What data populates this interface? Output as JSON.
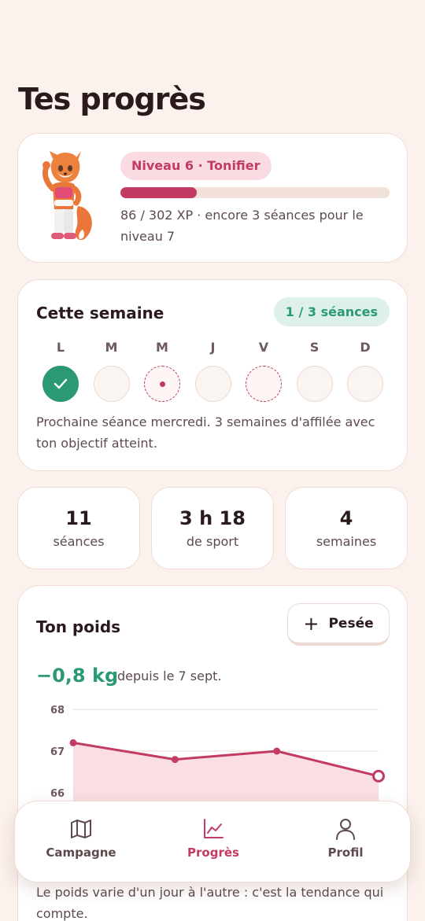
{
  "page": {
    "title": "Tes progrès"
  },
  "level_card": {
    "badge": "Niveau 6 · Tonifier",
    "xp_progress": 0.285,
    "xp_text": "86 / 302 XP · encore 3 séances pour le niveau 7"
  },
  "week": {
    "title": "Cette semaine",
    "badge": "1 / 3 séances",
    "days": [
      {
        "letter": "L",
        "state": "done"
      },
      {
        "letter": "M",
        "state": "empty"
      },
      {
        "letter": "M",
        "state": "today-planned"
      },
      {
        "letter": "J",
        "state": "empty"
      },
      {
        "letter": "V",
        "state": "planned"
      },
      {
        "letter": "S",
        "state": "empty"
      },
      {
        "letter": "D",
        "state": "empty"
      }
    ],
    "note": "Prochaine séance mercredi. 3 semaines d'affilée avec ton objectif atteint."
  },
  "stats": [
    {
      "value": "11",
      "label": "séances"
    },
    {
      "value": "3 h 18",
      "label": "de sport"
    },
    {
      "value": "4",
      "label": "semaines"
    }
  ],
  "weight": {
    "title": "Ton poids",
    "add_button": "Pesée",
    "delta": "−0,8 kg",
    "since": "depuis le 7 sept.",
    "footnote": "Le poids varie d'un jour à l'autre : c'est la tendance qui compte."
  },
  "chart_data": {
    "type": "area",
    "x": [
      1,
      2,
      3,
      4
    ],
    "values": [
      67.2,
      66.8,
      67.0,
      66.4
    ],
    "yticks": [
      "68",
      "67",
      "66"
    ],
    "ylim": [
      66,
      68
    ],
    "title": "",
    "xlabel": "",
    "ylabel": "",
    "line_color": "#c23b62",
    "fill_color": "#fbdde4"
  },
  "nav": {
    "items": [
      {
        "label": "Campagne",
        "icon": "map-icon",
        "active": false
      },
      {
        "label": "Progrès",
        "icon": "chart-icon",
        "active": true
      },
      {
        "label": "Profil",
        "icon": "user-icon",
        "active": false
      }
    ]
  },
  "colors": {
    "accent": "#c23b62",
    "success": "#2b9a72",
    "background": "#fbf1ed"
  }
}
